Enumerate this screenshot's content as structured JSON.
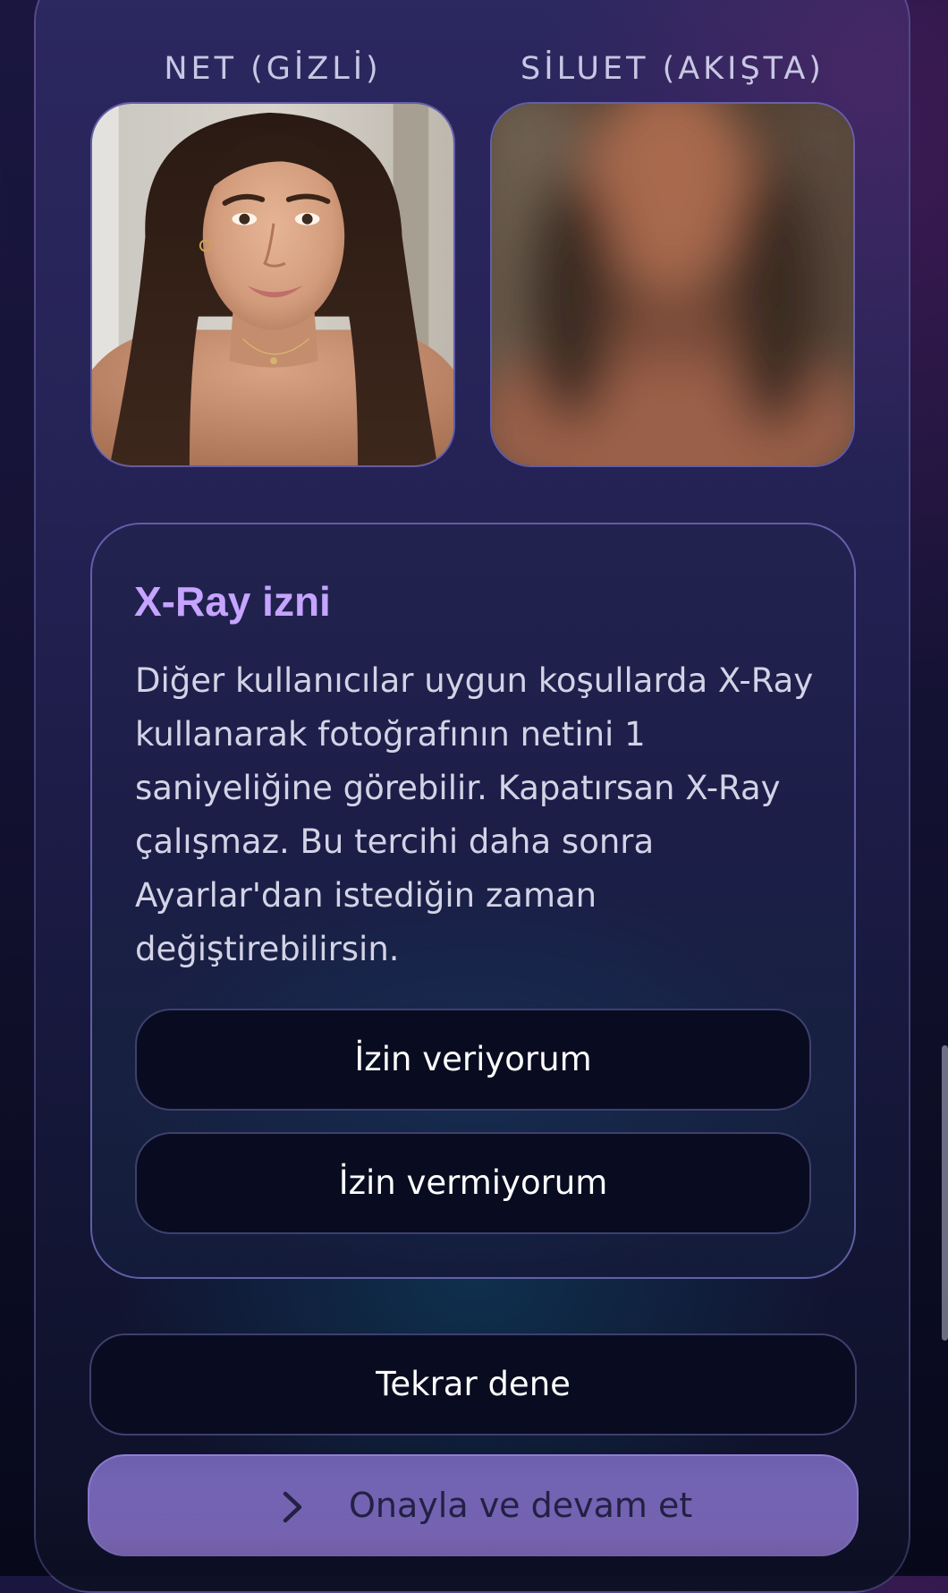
{
  "previews": {
    "net": {
      "label": "NET (GİZLİ)",
      "image_icon": "portrait-photo-clear"
    },
    "siluet": {
      "label": "SİLUET (AKIŞTA)",
      "image_icon": "portrait-photo-blurred"
    }
  },
  "permission": {
    "title": "X-Ray izni",
    "body_lines": [
      "Diğer kullanıcılar uygun koşullarda X-Ray",
      "kullanarak fotoğrafının netini 1",
      "saniyeliğine görebilir. Kapatırsan X-Ray",
      "çalışmaz. Bu tercihi daha sonra",
      "Ayarlar'dan istediğin zaman",
      "değiştirebilirsin."
    ],
    "allow_label": "İzin veriyorum",
    "deny_label": "İzin vermiyorum"
  },
  "actions": {
    "retry_label": "Tekrar dene",
    "confirm_label": "Onayla ve devam et",
    "confirm_icon": "chevron-right-icon"
  },
  "colors": {
    "title_accent": "#c6a4ff",
    "confirm_button": "#7b69bc",
    "button_bg": "#090c20"
  }
}
